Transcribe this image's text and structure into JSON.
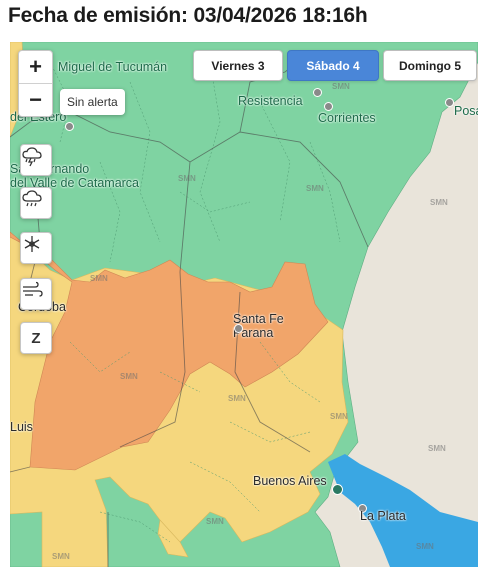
{
  "header": {
    "title": "Fecha de emisión: 03/04/2026 18:16h"
  },
  "tabs": [
    {
      "label": "Viernes 3",
      "active": false
    },
    {
      "label": "Sábado 4",
      "active": true
    },
    {
      "label": "Domingo 5",
      "active": false
    }
  ],
  "zoom": {
    "in_label": "+",
    "out_label": "−"
  },
  "tooltip": {
    "text": "Sin alerta"
  },
  "layers": [
    {
      "name": "storm-icon"
    },
    {
      "name": "rain-icon"
    },
    {
      "name": "snow-icon"
    },
    {
      "name": "wind-icon"
    },
    {
      "name": "zonda-icon",
      "glyph": "Z"
    }
  ],
  "places": {
    "tucuman": "Miguel de Tucumán",
    "estero": "del Estero",
    "catamarca1": "San Fernando",
    "catamarca2": "del Valle de Catamarca",
    "resistencia": "Resistencia",
    "corrientes": "Corrientes",
    "posadas": "Posa",
    "cordoba": "Córdoba",
    "santafe": "Santa Fe",
    "parana": "Parana",
    "buenosaires": "Buenos Aires",
    "laplata": "La Plata",
    "sanluis": "Luis"
  },
  "watermark": "SMN",
  "colors": {
    "no_alert": "#7fd3a2",
    "yellow": "#f5d77e",
    "orange": "#f1a56a",
    "water": "#3aa7e3",
    "land": "#e9e4da"
  }
}
